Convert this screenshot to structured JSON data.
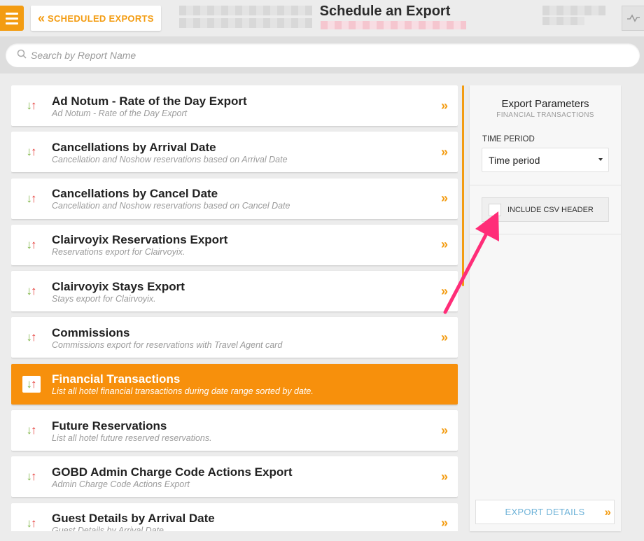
{
  "header": {
    "menu_icon": "hamburger-icon",
    "back_label": "SCHEDULED EXPORTS",
    "back_icon": "double-chevron-left-icon",
    "title": "Schedule an Export",
    "right_icon": "activity-icon"
  },
  "search": {
    "placeholder": "Search by Report Name",
    "icon": "search-icon"
  },
  "reports": [
    {
      "title": "Ad Notum - Rate of the Day Export",
      "desc": "Ad Notum - Rate of the Day Export",
      "active": false
    },
    {
      "title": "Cancellations by Arrival Date",
      "desc": "Cancellation and Noshow reservations based on Arrival Date",
      "active": false
    },
    {
      "title": "Cancellations by Cancel Date",
      "desc": "Cancellation and Noshow reservations based on Cancel Date",
      "active": false
    },
    {
      "title": "Clairvoyix Reservations Export",
      "desc": "Reservations export for Clairvoyix.",
      "active": false
    },
    {
      "title": "Clairvoyix Stays Export",
      "desc": "Stays export for Clairvoyix.",
      "active": false
    },
    {
      "title": "Commissions",
      "desc": "Commissions export for reservations with Travel Agent card",
      "active": false
    },
    {
      "title": "Financial Transactions",
      "desc": "List all hotel financial transactions during date range sorted by date.",
      "active": true
    },
    {
      "title": "Future Reservations",
      "desc": "List all hotel future reserved reservations.",
      "active": false
    },
    {
      "title": "GOBD Admin Charge Code Actions Export",
      "desc": "Admin Charge Code Actions Export",
      "active": false
    },
    {
      "title": "Guest Details by Arrival Date",
      "desc": "Guest Details by Arrival Date",
      "active": false
    }
  ],
  "panel": {
    "title": "Export Parameters",
    "subtitle": "FINANCIAL TRANSACTIONS",
    "time_period_label": "TIME PERIOD",
    "time_period_value": "Time period",
    "csv_header_label": "INCLUDE CSV HEADER",
    "csv_header_checked": false,
    "export_button": "EXPORT DETAILS"
  },
  "colors": {
    "accent": "#f39c12",
    "active_row": "#f7900c",
    "arrow_down": "#7cb342",
    "arrow_up": "#e53935",
    "annotation": "#ff2d78",
    "export_text": "#6fb3d8"
  }
}
